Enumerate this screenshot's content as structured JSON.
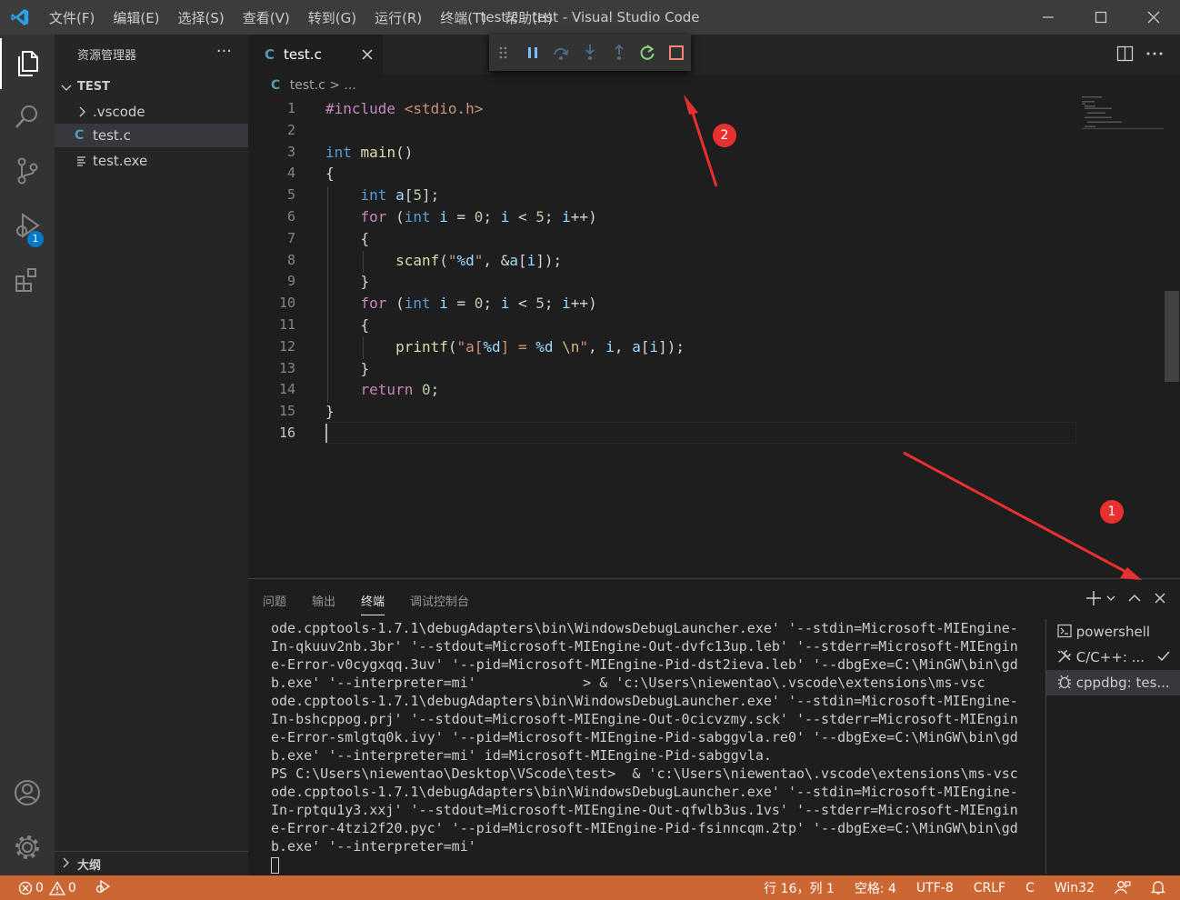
{
  "titlebar": {
    "menu": [
      "文件(F)",
      "编辑(E)",
      "选择(S)",
      "查看(V)",
      "转到(G)",
      "运行(R)",
      "终端(T)",
      "帮助(H)"
    ],
    "title": "test.c - test - Visual Studio Code"
  },
  "activity": {
    "icons": [
      "explorer-icon",
      "search-icon",
      "source-control-icon",
      "run-debug-icon",
      "extensions-icon",
      "account-icon",
      "gear-icon"
    ],
    "debug_badge": "1"
  },
  "sidebar": {
    "title": "资源管理器",
    "more": "···",
    "folder": "TEST",
    "items": [
      ".vscode",
      "test.c",
      "test.exe"
    ],
    "outline": "大纲"
  },
  "editor": {
    "tab_icon": "C",
    "tab_label": "test.c",
    "breadcrumb_file": "test.c",
    "breadcrumb_rest": "...",
    "line_numbers": [
      "1",
      "2",
      "3",
      "4",
      "5",
      "6",
      "7",
      "8",
      "9",
      "10",
      "11",
      "12",
      "13",
      "14",
      "15",
      "16"
    ]
  },
  "panel": {
    "tabs": [
      "问题",
      "输出",
      "终端",
      "调试控制台"
    ],
    "active_tab": "终端",
    "terminal_lines": [
      "ode.cpptools-1.7.1\\debugAdapters\\bin\\WindowsDebugLauncher.exe' '--stdin=Microsoft-MIEngine-",
      "In-qkuuv2nb.3br' '--stdout=Microsoft-MIEngine-Out-dvfc13up.leb' '--stderr=Microsoft-MIEngin",
      "e-Error-v0cygxqq.3uv' '--pid=Microsoft-MIEngine-Pid-dst2ieva.leb' '--dbgExe=C:\\MinGW\\bin\\gd",
      "b.exe' '--interpreter=mi'             > & 'c:\\Users\\niewentao\\.vscode\\extensions\\ms-vsc",
      "ode.cpptools-1.7.1\\debugAdapters\\bin\\WindowsDebugLauncher.exe' '--stdin=Microsoft-MIEngine-",
      "In-bshcppog.prj' '--stdout=Microsoft-MIEngine-Out-0cicvzmy.sck' '--stderr=Microsoft-MIEngin",
      "e-Error-smlgtq0k.ivy' '--pid=Microsoft-MIEngine-Pid-sabggvla.re0' '--dbgExe=C:\\MinGW\\bin\\gd",
      "b.exe' '--interpreter=mi' id=Microsoft-MIEngine-Pid-sabggvla.",
      "PS C:\\Users\\niewentao\\Desktop\\VScode\\test>  & 'c:\\Users\\niewentao\\.vscode\\extensions\\ms-vsc",
      "ode.cpptools-1.7.1\\debugAdapters\\bin\\WindowsDebugLauncher.exe' '--stdin=Microsoft-MIEngine-",
      "In-rptqu1y3.xxj' '--stdout=Microsoft-MIEngine-Out-qfwlb3us.1vs' '--stderr=Microsoft-MIEngin",
      "e-Error-4tzi2f20.pyc' '--pid=Microsoft-MIEngine-Pid-fsinncqm.2tp' '--dbgExe=C:\\MinGW\\bin\\gd",
      "b.exe' '--interpreter=mi'"
    ],
    "terminals": [
      "powershell",
      "C/C++: ...",
      "cppdbg: tes..."
    ]
  },
  "status": {
    "errors": "0",
    "warnings": "0",
    "position": "行 16，列 1",
    "spaces": "空格: 4",
    "encoding": "UTF-8",
    "eol": "CRLF",
    "language": "C",
    "platform": "Win32"
  },
  "annotations": [
    "1",
    "2"
  ],
  "colors": {
    "statusbar": "#cc6633",
    "accent": "#007acc",
    "marker": "#e83030"
  }
}
